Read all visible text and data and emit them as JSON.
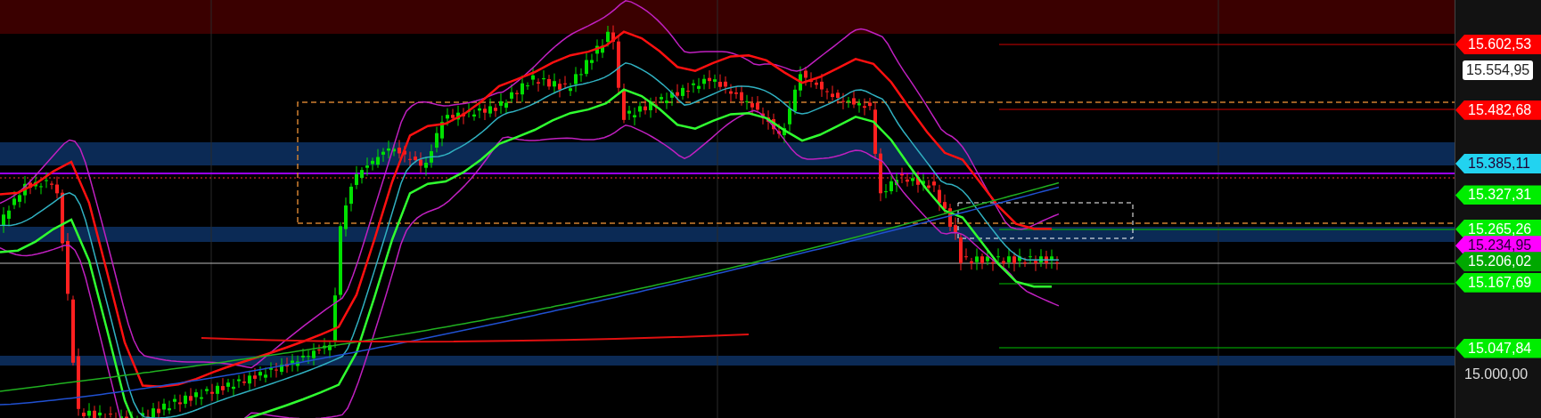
{
  "price_axis": {
    "labels": [
      {
        "text": "15.602,53",
        "kind": "tag",
        "color": "#ff0000"
      },
      {
        "text": "15.554,95",
        "kind": "box",
        "color": "#ffffff"
      },
      {
        "text": "15.482,68",
        "kind": "tag",
        "color": "#ff0000"
      },
      {
        "text": "15.385,11",
        "kind": "tag",
        "color": "#22d3f0"
      },
      {
        "text": "15.327,31",
        "kind": "tag",
        "color": "#00ee00"
      },
      {
        "text": "15.265,26",
        "kind": "tag",
        "color": "#00ee00"
      },
      {
        "text": "15.234,95",
        "kind": "tag",
        "color": "#ff00ff"
      },
      {
        "text": "15.206,02",
        "kind": "tag",
        "color": "#00a800"
      },
      {
        "text": "15.167,69",
        "kind": "tag",
        "color": "#00ee00"
      },
      {
        "text": "15.047,84",
        "kind": "tag",
        "color": "#00ee00"
      },
      {
        "text": "15.000,00",
        "kind": "plain",
        "color": "#dddddd"
      }
    ]
  }
}
